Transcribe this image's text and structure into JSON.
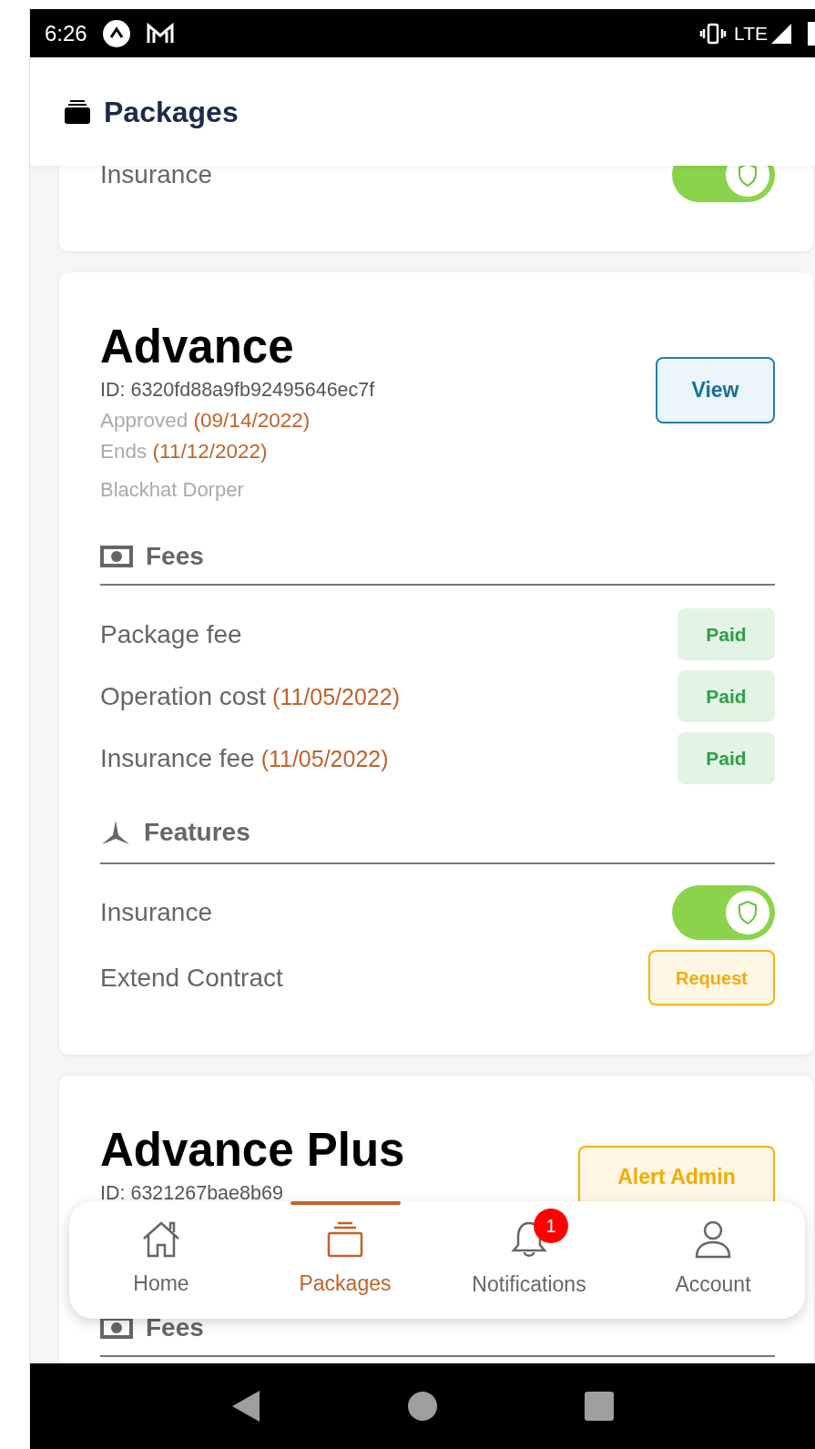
{
  "status_bar": {
    "time": "6:26",
    "network": "LTE"
  },
  "header": {
    "title": "Packages"
  },
  "previous_card": {
    "features": [
      {
        "kind": "toggle",
        "label": "Insurance",
        "on": true
      }
    ]
  },
  "packages": [
    {
      "name": "Advance",
      "id": "ID: 6320fd88a9fb92495646ec7f",
      "approved": {
        "label": "Approved",
        "date": "(09/14/2022)"
      },
      "ends": {
        "label": "Ends",
        "date": "(11/12/2022)"
      },
      "breed": "Blackhat Dorper",
      "action": {
        "kind": "view",
        "label": "View"
      },
      "fees_title": "Fees",
      "fees": [
        {
          "label": "Package fee",
          "status": "Paid"
        },
        {
          "label": "Operation cost",
          "date": "(11/05/2022)",
          "status": "Paid"
        },
        {
          "label": "Insurance fee",
          "date": "(11/05/2022)",
          "status": "Paid"
        }
      ],
      "features_title": "Features",
      "features": [
        {
          "kind": "toggle",
          "label": "Insurance",
          "on": true
        },
        {
          "kind": "button",
          "label": "Extend Contract",
          "button": "Request"
        }
      ]
    },
    {
      "name": "Advance Plus",
      "id": "ID: 6321267bae8b69",
      "action": {
        "kind": "alert",
        "label": "Alert Admin"
      },
      "fees_title": "Fees"
    }
  ],
  "bottom_nav": [
    {
      "label": "Home",
      "kind": "home",
      "selected": false
    },
    {
      "label": "Packages",
      "kind": "packages",
      "selected": true
    },
    {
      "label": "Notifications",
      "kind": "bell",
      "selected": false,
      "badge": "1"
    },
    {
      "label": "Account",
      "kind": "account",
      "selected": false
    }
  ]
}
